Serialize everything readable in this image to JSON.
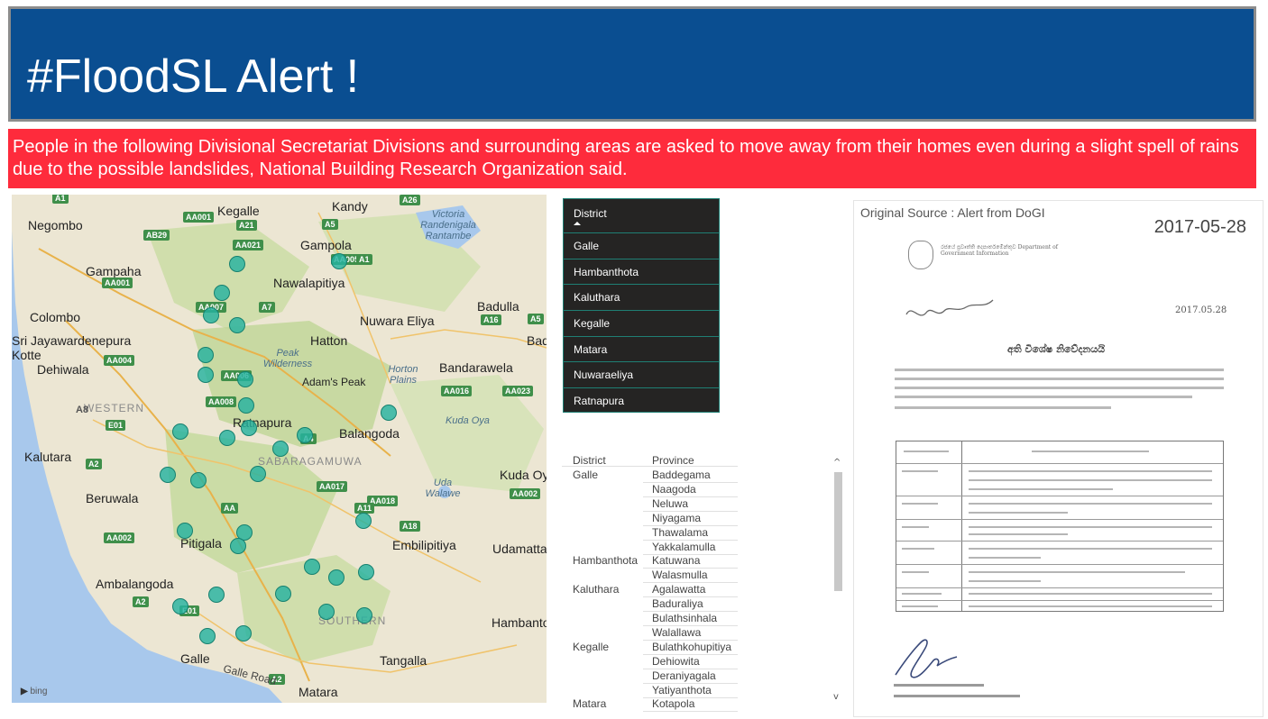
{
  "header": {
    "title": "#FloodSL Alert !"
  },
  "banner": {
    "text": "People in the following Divisional Secretariat Divisions and surrounding areas are asked to move away from their homes even during a slight spell of rains due to the possible landslides, National Building Research Organization said."
  },
  "colors": {
    "header_bg": "#0a4e91",
    "banner_bg": "#fe2b3c",
    "slicer_bg": "#252423",
    "slicer_border": "#1f7f74",
    "marker": "#26b2a0"
  },
  "map": {
    "places": [
      "Negombo",
      "Kegalle",
      "Kandy",
      "Gampaha",
      "Gampola",
      "Nawalapitiya",
      "Colombo",
      "Badulla",
      "Nuwara Eliya",
      "Sri Jayawardenepura Kotte",
      "Hatton",
      "Dehiwala",
      "Bandarawela",
      "Adam's Peak",
      "Ratnapura",
      "Balangoda",
      "Kalutara",
      "Kuda Oya",
      "Beruwala",
      "Pitigala",
      "Embilipitiya",
      "Udamattala",
      "Ambalangoda",
      "Hambantota",
      "Galle",
      "Tangalla",
      "Matara",
      "Bad"
    ],
    "regions": [
      "WESTERN",
      "SABARAGAMUWA",
      "SOUTHERN"
    ],
    "parks": [
      "Victoria Randenigala Rantambe",
      "Peak Wilderness",
      "Horton Plains",
      "Kuda Oya",
      "Uda Walawe"
    ],
    "roads": [
      "A1",
      "A26",
      "AA001",
      "A21",
      "A5",
      "AB29",
      "AA021",
      "AA005",
      "AA001",
      "A7",
      "AA007",
      "A16",
      "AA004",
      "AA006",
      "AA008",
      "AA016",
      "AA023",
      "A8",
      "E01",
      "A2",
      "AA017",
      "AA018",
      "AA002",
      "A18",
      "AA002",
      "A2",
      "E01",
      "A2",
      "A5",
      "A4",
      "A1",
      "A11",
      "AA"
    ],
    "galle_road": "Galle Road",
    "attribution": "bing"
  },
  "slicer": {
    "title": "District",
    "items": [
      "Galle",
      "Hambanthota",
      "Kaluthara",
      "Kegalle",
      "Matara",
      "Nuwaraeliya",
      "Ratnapura"
    ]
  },
  "table": {
    "columns": [
      "District",
      "Province"
    ],
    "rows": [
      [
        "Galle",
        "Baddegama"
      ],
      [
        "",
        "Naagoda"
      ],
      [
        "",
        "Neluwa"
      ],
      [
        "",
        "Niyagama"
      ],
      [
        "",
        "Thawalama"
      ],
      [
        "",
        "Yakkalamulla"
      ],
      [
        "Hambanthota",
        "Katuwana"
      ],
      [
        "",
        "Walasmulla"
      ],
      [
        "Kaluthara",
        "Agalawatta"
      ],
      [
        "",
        "Baduraliya"
      ],
      [
        "",
        "Bulathsinhala"
      ],
      [
        "",
        "Walallawa"
      ],
      [
        "Kegalle",
        "Bulathkohupitiya"
      ],
      [
        "",
        "Dehiowita"
      ],
      [
        "",
        "Deraniyagala"
      ],
      [
        "",
        "Yatiyanthota"
      ],
      [
        "Matara",
        "Kotapola"
      ]
    ]
  },
  "doc": {
    "title": "Original Source : Alert from DoGI",
    "date": "2017-05-28",
    "letter_date": "2017.05.28",
    "heading": "අති විශේෂ නිවේදනයයි",
    "dept": "රජයේ ප්‍රවෘත්ති දෙපාර්තමේන්තුව Department of Government Information"
  }
}
